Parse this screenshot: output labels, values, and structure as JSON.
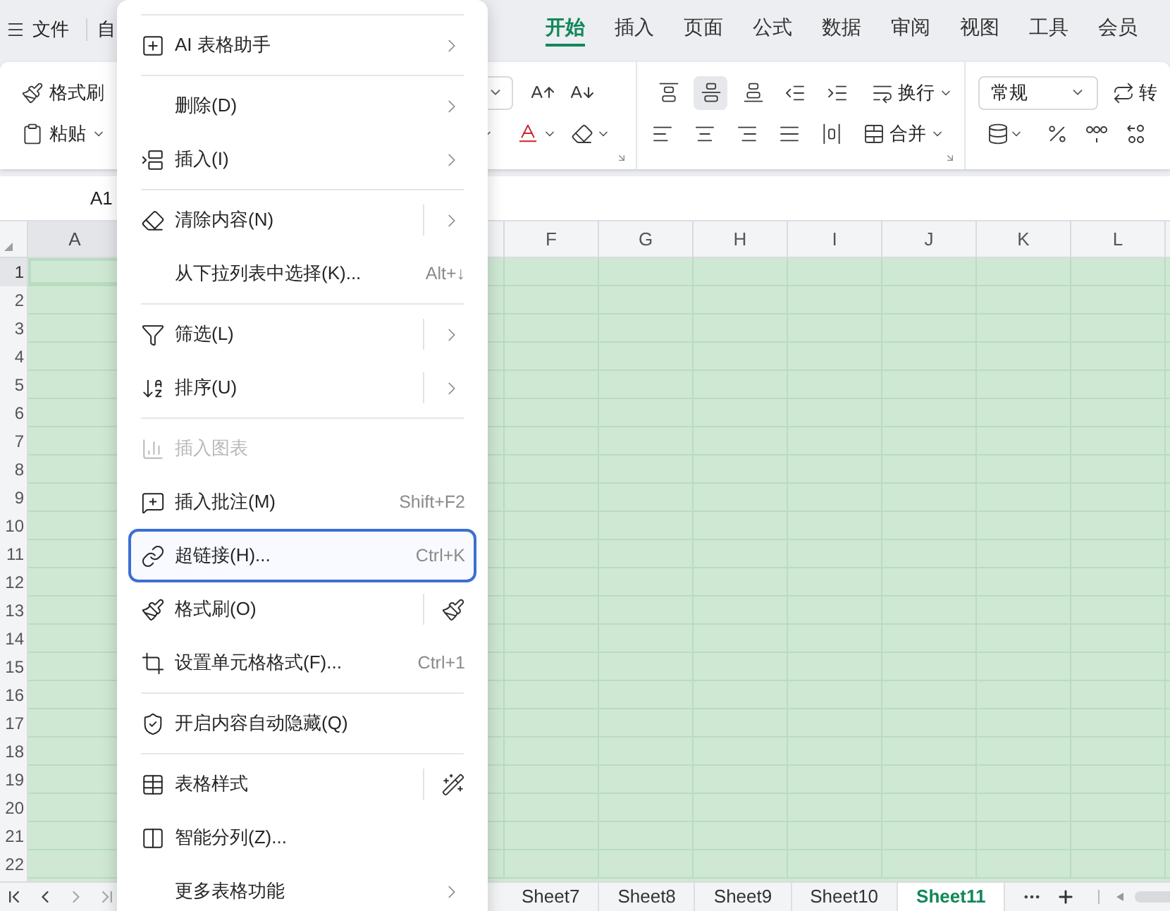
{
  "top_bar": {
    "file_menu": "文件",
    "next_menu": "自",
    "tabs": [
      {
        "label": "开始",
        "selected": true
      },
      {
        "label": "插入",
        "selected": false
      },
      {
        "label": "页面",
        "selected": false
      },
      {
        "label": "公式",
        "selected": false
      },
      {
        "label": "数据",
        "selected": false
      },
      {
        "label": "审阅",
        "selected": false
      },
      {
        "label": "视图",
        "selected": false
      },
      {
        "label": "工具",
        "selected": false
      },
      {
        "label": "会员",
        "selected": false
      }
    ]
  },
  "ribbon": {
    "format_painter": "格式刷",
    "paste": "粘贴",
    "wrap_text": "换行",
    "merge": "合并",
    "number_format": "常规",
    "convert": "转",
    "vertical_align": [
      {
        "selected": false
      },
      {
        "selected": true
      },
      {
        "selected": false
      }
    ]
  },
  "name_box": "A1",
  "columns": [
    {
      "label": "A",
      "selected": true
    },
    {
      "label": "F",
      "selected": false
    },
    {
      "label": "G",
      "selected": false
    },
    {
      "label": "H",
      "selected": false
    },
    {
      "label": "I",
      "selected": false
    },
    {
      "label": "J",
      "selected": false
    },
    {
      "label": "K",
      "selected": false
    },
    {
      "label": "L",
      "selected": false
    }
  ],
  "rows": [
    {
      "label": "1",
      "selected": true
    },
    {
      "label": "2",
      "selected": false
    },
    {
      "label": "3",
      "selected": false
    },
    {
      "label": "4",
      "selected": false
    },
    {
      "label": "5",
      "selected": false
    },
    {
      "label": "6",
      "selected": false
    },
    {
      "label": "7",
      "selected": false
    },
    {
      "label": "8",
      "selected": false
    },
    {
      "label": "9",
      "selected": false
    },
    {
      "label": "10",
      "selected": false
    },
    {
      "label": "11",
      "selected": false
    },
    {
      "label": "12",
      "selected": false
    },
    {
      "label": "13",
      "selected": false
    },
    {
      "label": "14",
      "selected": false
    },
    {
      "label": "15",
      "selected": false
    },
    {
      "label": "16",
      "selected": false
    },
    {
      "label": "17",
      "selected": false
    },
    {
      "label": "18",
      "selected": false
    },
    {
      "label": "19",
      "selected": false
    },
    {
      "label": "20",
      "selected": false
    },
    {
      "label": "21",
      "selected": false
    },
    {
      "label": "22",
      "selected": false
    }
  ],
  "sheet_tabs": [
    {
      "label": "Sheet7",
      "selected": false
    },
    {
      "label": "Sheet8",
      "selected": false
    },
    {
      "label": "Sheet9",
      "selected": false
    },
    {
      "label": "Sheet10",
      "selected": false
    },
    {
      "label": "Sheet11",
      "selected": true
    }
  ],
  "context_menu": {
    "items": [
      {
        "kind": "separator"
      },
      {
        "kind": "submenu",
        "label": "AI 表格助手",
        "disabled": false,
        "highlighted": false
      },
      {
        "kind": "separator"
      },
      {
        "kind": "submenu",
        "label": "删除(D)",
        "disabled": false,
        "highlighted": false
      },
      {
        "kind": "submenu",
        "label": "插入(I)",
        "disabled": false,
        "highlighted": false
      },
      {
        "kind": "separator"
      },
      {
        "kind": "split-submenu",
        "label": "清除内容(N)",
        "disabled": false,
        "highlighted": false
      },
      {
        "kind": "shortcut",
        "label": "从下拉列表中选择(K)...",
        "shortcut": "Alt+↓",
        "disabled": false,
        "highlighted": false
      },
      {
        "kind": "separator"
      },
      {
        "kind": "split-submenu",
        "label": "筛选(L)",
        "disabled": false,
        "highlighted": false
      },
      {
        "kind": "split-submenu",
        "label": "排序(U)",
        "disabled": false,
        "highlighted": false
      },
      {
        "kind": "separator"
      },
      {
        "kind": "plain",
        "label": "插入图表",
        "disabled": true,
        "highlighted": false
      },
      {
        "kind": "shortcut",
        "label": "插入批注(M)",
        "shortcut": "Shift+F2",
        "disabled": false,
        "highlighted": false
      },
      {
        "kind": "shortcut",
        "label": "超链接(H)...",
        "shortcut": "Ctrl+K",
        "disabled": false,
        "highlighted": true
      },
      {
        "kind": "split-tool",
        "label": "格式刷(O)",
        "disabled": false,
        "highlighted": false
      },
      {
        "kind": "shortcut",
        "label": "设置单元格格式(F)...",
        "shortcut": "Ctrl+1",
        "disabled": false,
        "highlighted": false
      },
      {
        "kind": "separator"
      },
      {
        "kind": "plain",
        "label": "开启内容自动隐藏(Q)",
        "disabled": false,
        "highlighted": false
      },
      {
        "kind": "separator"
      },
      {
        "kind": "split-tool",
        "label": "表格样式",
        "disabled": false,
        "highlighted": false
      },
      {
        "kind": "plain",
        "label": "智能分列(Z)...",
        "disabled": false,
        "highlighted": false
      },
      {
        "kind": "submenu",
        "label": "更多表格功能",
        "disabled": false,
        "highlighted": false
      }
    ]
  }
}
